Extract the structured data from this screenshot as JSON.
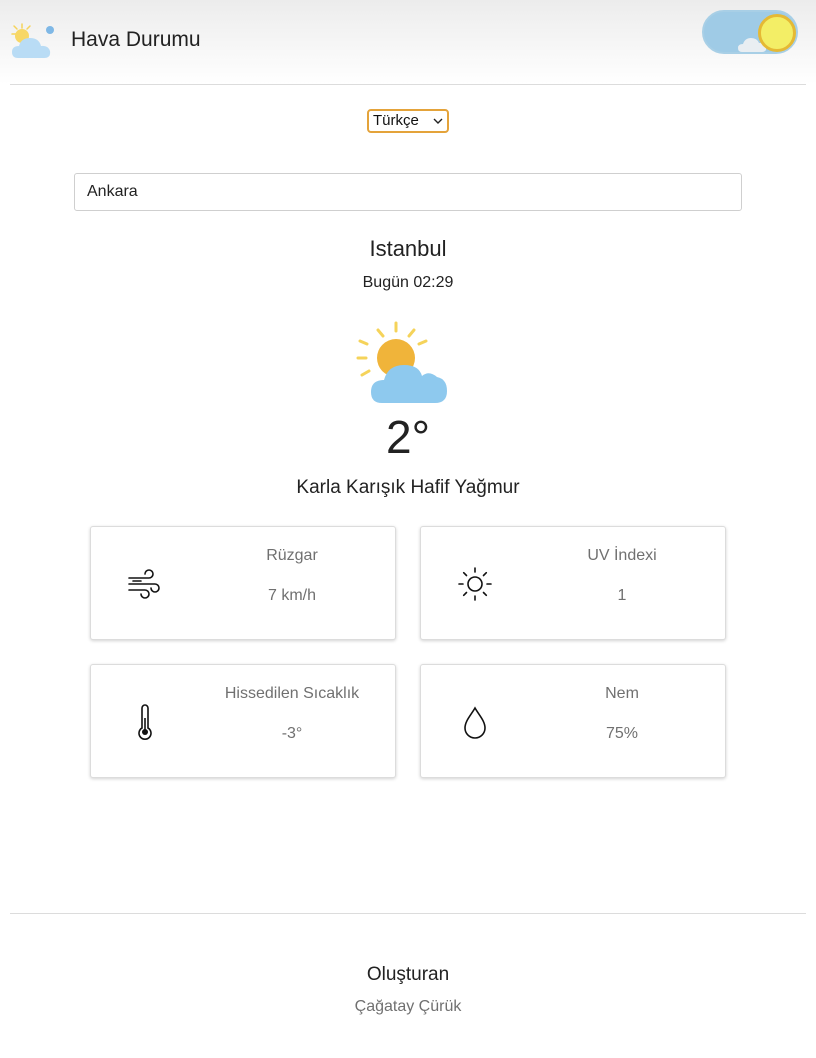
{
  "header": {
    "title": "Hava Durumu",
    "logo_icon": "sun-cloud-moon-icon",
    "theme_toggle": {
      "mode": "light",
      "knob_color": "#f3ee66",
      "track_color": "#9fcbe6"
    }
  },
  "language": {
    "selected": "Türkçe"
  },
  "search": {
    "value": "Ankara"
  },
  "weather": {
    "city": "Istanbul",
    "datetime": "Bugün 02:29",
    "temperature": "2°",
    "condition": "Karla Karışık Hafif Yağmur",
    "icon": "sun-behind-cloud-icon"
  },
  "details": [
    {
      "label": "Rüzgar",
      "value": "7 km/h",
      "icon": "wind-icon"
    },
    {
      "label": "UV İndexi",
      "value": "1",
      "icon": "sun-icon"
    },
    {
      "label": "Hissedilen Sıcaklık",
      "value": "-3°",
      "icon": "thermometer-icon"
    },
    {
      "label": "Nem",
      "value": "75%",
      "icon": "droplet-icon"
    }
  ],
  "footer": {
    "title": "Oluşturan",
    "author": "Çağatay Çürük"
  },
  "colors": {
    "accent_border": "#e4a33a",
    "sun": "#f0b43a",
    "cloud": "#8ec9ee",
    "muted_text": "#707070"
  }
}
